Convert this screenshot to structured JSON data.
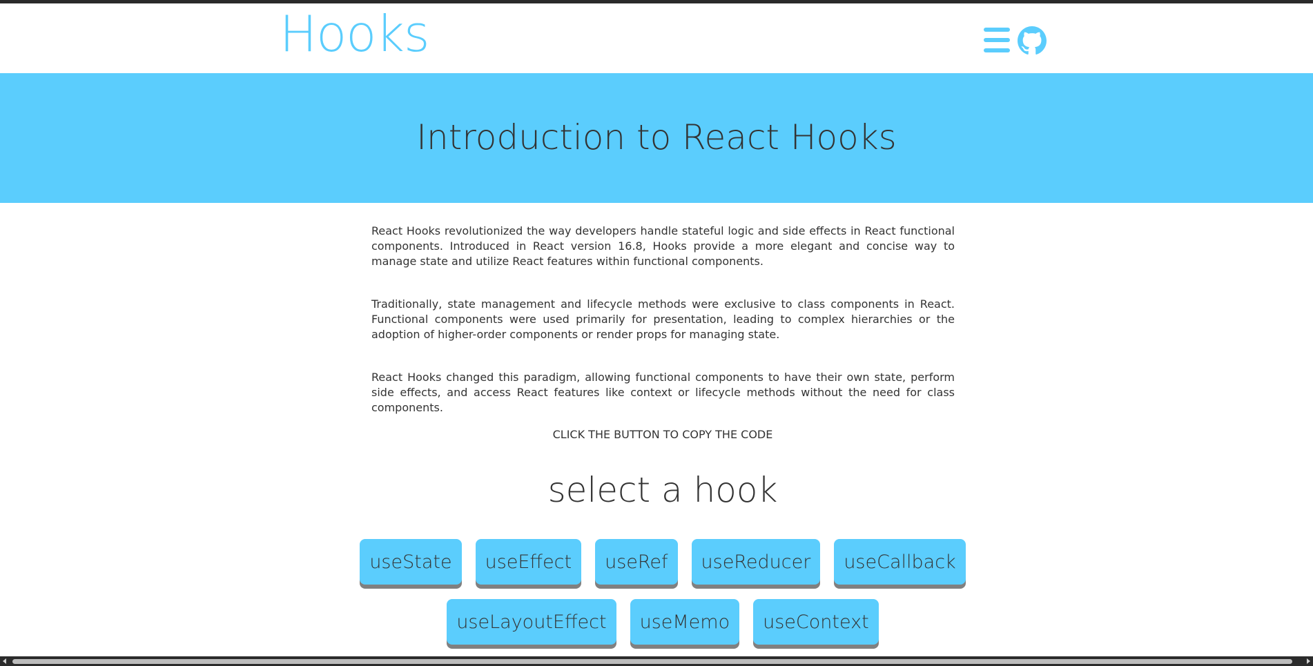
{
  "header": {
    "logo_text": "Hooks",
    "menu_icon": "hamburger-menu-icon",
    "github_icon": "github-icon"
  },
  "hero": {
    "title": "Introduction to React Hooks"
  },
  "intro": {
    "paragraphs": [
      "React Hooks revolutionized the way developers handle stateful logic and side effects in React functional components. Introduced in React version 16.8, Hooks provide a more elegant and concise way to manage state and utilize React features within functional components.",
      "Traditionally, state management and lifecycle methods were exclusive to class components in React. Functional components were used primarily for presentation, leading to complex hierarchies or the adoption of higher-order components or render props for managing state.",
      "React Hooks changed this paradigm, allowing functional components to have their own state, perform side effects, and access React features like context or lifecycle methods without the need for class components."
    ]
  },
  "copy_instruction": "CLICK THE BUTTON TO COPY THE CODE",
  "hook_selector": {
    "heading": "select a hook",
    "hooks": [
      "useState",
      "useEffect",
      "useRef",
      "useReducer",
      "useCallback",
      "useLayoutEffect",
      "useMemo",
      "useContext"
    ]
  },
  "colors": {
    "accent": "#5bcdfd",
    "text": "#333333",
    "button_shadow": "#808080",
    "top_strip": "#2b2b2b"
  }
}
